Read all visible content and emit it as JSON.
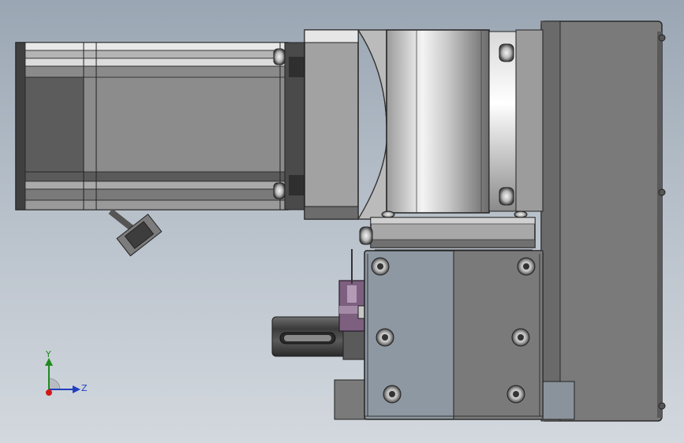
{
  "triad": {
    "y_label": "Y",
    "z_label": "Z"
  },
  "colors": {
    "background_top": "#9aa6b3",
    "background_bottom": "#d3d8de",
    "y_axis": "#1f8a1f",
    "z_axis": "#1f3fbf",
    "x_axis": "#d01818",
    "motor_body": "#8d8d8d",
    "motor_dark": "#4a4a4a",
    "plate": "#777777",
    "bracket_light": "#8e98a2",
    "slider": "#7e5e7e"
  },
  "icons": [
    "coordinate-triad-icon"
  ]
}
